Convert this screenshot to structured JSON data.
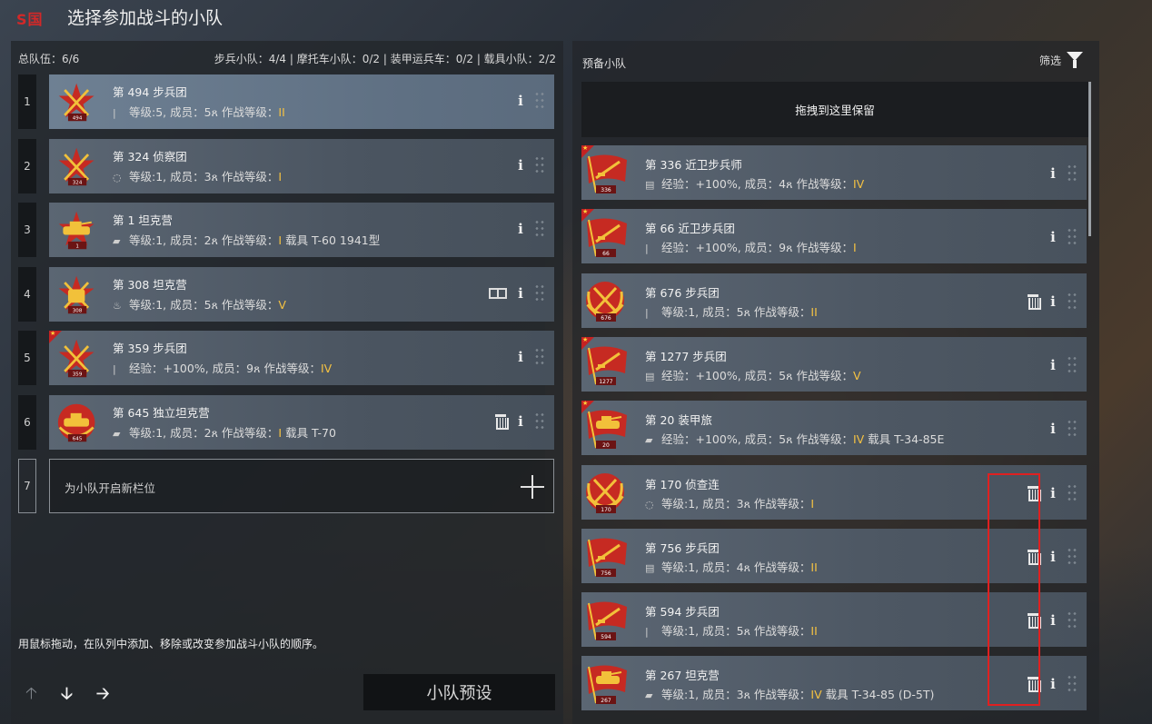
{
  "header": {
    "logo": "S国",
    "title": "选择参加战斗的小队"
  },
  "left": {
    "total": "总队伍：6/6",
    "counts": "步兵小队：4/4 | 摩托车小队：0/2 | 装甲运兵车：0/2 | 载具小队：2/2",
    "slots": [
      {
        "num": "1",
        "name": "第 494 步兵团",
        "type_icon": "|",
        "info": "等级:5, 成员：5",
        "member_icon": "person-icon",
        "combat": "作战等级：",
        "level": "II",
        "vehicle": "",
        "badge": "494",
        "emblem": "infantry"
      },
      {
        "num": "2",
        "name": "第 324 侦察团",
        "type_icon": "◌",
        "info": "等级:1, 成员：3",
        "member_icon": "person-icon",
        "combat": "作战等级：",
        "level": "I",
        "vehicle": "",
        "badge": "324",
        "emblem": "infantry"
      },
      {
        "num": "3",
        "name": "第 1 坦克营",
        "type_icon": "▰",
        "info": "等级:1, 成员：2",
        "member_icon": "person-icon",
        "combat": "作战等级：",
        "level": "I",
        "vehicle": " 载具 T-60 1941型",
        "badge": "1",
        "emblem": "tank"
      },
      {
        "num": "4",
        "name": "第 308 坦克营",
        "type_icon": "♨",
        "info": "等级:1, 成员：5",
        "member_icon": "person-icon",
        "combat": "作战等级：",
        "level": "V",
        "vehicle": "",
        "badge": "308",
        "emblem": "infantry-yellow"
      },
      {
        "num": "5",
        "name": "第 359 步兵团",
        "type_icon": "|",
        "info": "经验：+100%, 成员：9",
        "member_icon": "person-icon",
        "combat": "作战等级：",
        "level": "IV",
        "vehicle": "",
        "badge": "359",
        "emblem": "infantry"
      },
      {
        "num": "6",
        "name": "第 645 独立坦克营",
        "type_icon": "▰",
        "info": "等级:1, 成员：2",
        "member_icon": "person-icon",
        "combat": "作战等级：",
        "level": "I",
        "vehicle": " 载具 T-70",
        "badge": "645",
        "emblem": "tank-round"
      }
    ],
    "empty_slot": {
      "num": "7",
      "label": "为小队开启新栏位"
    },
    "hint": "用鼠标拖动，在队列中添加、移除或改变参加战斗小队的顺序。",
    "preset_button": "小队预设"
  },
  "right": {
    "title": "预备小队",
    "filter": "筛选",
    "dropzone": "拖拽到这里保留",
    "items": [
      {
        "name": "第 336 近卫步兵师",
        "type_icon": "▤",
        "info": "经验：+100%, 成员：4",
        "combat": "作战等级：",
        "level": "IV",
        "vehicle": "",
        "badge": "336",
        "emblem": "flag",
        "trash": false,
        "star": true
      },
      {
        "name": "第 66 近卫步兵团",
        "type_icon": "|",
        "info": "经验：+100%, 成员：9",
        "combat": "作战等级：",
        "level": "I",
        "vehicle": "",
        "badge": "66",
        "emblem": "flag",
        "trash": false,
        "star": true
      },
      {
        "name": "第 676 步兵团",
        "type_icon": "|",
        "info": "等级:1, 成员：5",
        "combat": "作战等级：",
        "level": "II",
        "vehicle": "",
        "badge": "676",
        "emblem": "wreath",
        "trash": true,
        "star": false
      },
      {
        "name": "第 1277 步兵团",
        "type_icon": "▤",
        "info": "经验：+100%, 成员：5",
        "combat": "作战等级：",
        "level": "V",
        "vehicle": "",
        "badge": "1277",
        "emblem": "flag",
        "trash": false,
        "star": true
      },
      {
        "name": "第 20 装甲旅",
        "type_icon": "▰",
        "info": "经验：+100%, 成员：5",
        "combat": "作战等级：",
        "level": "IV",
        "vehicle": " 载具 T-34-85E",
        "badge": "20",
        "emblem": "flag-tank",
        "trash": false,
        "star": true
      },
      {
        "name": "第 170 侦查连",
        "type_icon": "◌",
        "info": "等级:1, 成员：3",
        "combat": "作战等级：",
        "level": "I",
        "vehicle": "",
        "badge": "170",
        "emblem": "wreath",
        "trash": true,
        "star": false
      },
      {
        "name": "第 756 步兵团",
        "type_icon": "▤",
        "info": "等级:1, 成员：4",
        "combat": "作战等级：",
        "level": "II",
        "vehicle": "",
        "badge": "756",
        "emblem": "flag",
        "trash": true,
        "star": false
      },
      {
        "name": "第 594 步兵团",
        "type_icon": "|",
        "info": "等级:1, 成员：5",
        "combat": "作战等级：",
        "level": "II",
        "vehicle": "",
        "badge": "594",
        "emblem": "flag",
        "trash": true,
        "star": false
      },
      {
        "name": "第 267 坦克营",
        "type_icon": "▰",
        "info": "等级:1, 成员：3",
        "combat": "作战等级：",
        "level": "IV",
        "vehicle": " 载具 T-34-85 (D-5T)",
        "badge": "267",
        "emblem": "flag-tank",
        "trash": true,
        "star": false
      }
    ]
  },
  "colors": {
    "level": "#f5c242",
    "highlight": "#e02020",
    "logo": "#d32828"
  }
}
